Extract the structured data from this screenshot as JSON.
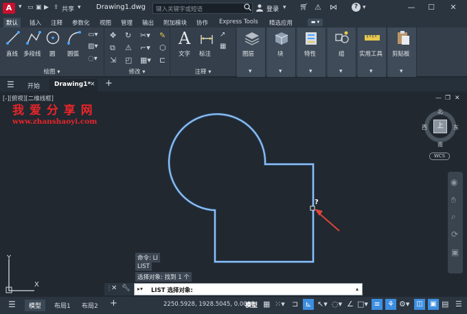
{
  "titlebar": {
    "share": "共享",
    "document": "Drawing1.dwg",
    "search_placeholder": "键入关键字或短语",
    "login": "登录"
  },
  "ribbon_tabs": [
    "默认",
    "插入",
    "注释",
    "参数化",
    "视图",
    "管理",
    "输出",
    "附加模块",
    "协作",
    "Express Tools",
    "精选应用"
  ],
  "panels": {
    "draw": "绘图",
    "modify": "修改",
    "annotation": "注释",
    "layers": "图层",
    "block": "块",
    "properties": "特性",
    "group": "组",
    "utilities": "实用工具",
    "clipboard": "剪贴板"
  },
  "draw_tools": {
    "line": "直线",
    "polyline": "多段线",
    "circle": "圆",
    "arc": "圆弧"
  },
  "annotation_tools": {
    "text": "文字",
    "dimension": "标注"
  },
  "doc_tabs": {
    "start": "开始",
    "drawing": "Drawing1*"
  },
  "viewport_label": "[-][俯视][二维线框]",
  "watermark": {
    "title": "我 爱 分 享 网",
    "url": "www.zhanshaoyi.com"
  },
  "viewcube": {
    "north": "北",
    "south": "南",
    "east": "东",
    "west": "西",
    "top": "上",
    "wcs": "WCS"
  },
  "cursor_hint": "?",
  "command_history": [
    "命令: LI",
    "LIST",
    "选择对象: 找到 1 个"
  ],
  "command_prompt": "LIST 选择对象:",
  "layout_tabs": [
    "模型",
    "布局1",
    "布局2"
  ],
  "coordinates": "2250.5928, 1928.5045, 0.0000",
  "status_model": "模型",
  "colors": {
    "accent": "#3d8ee0",
    "shape": "#bcd9ff",
    "watermark": "#e8252a",
    "arrow": "#e0453a"
  }
}
